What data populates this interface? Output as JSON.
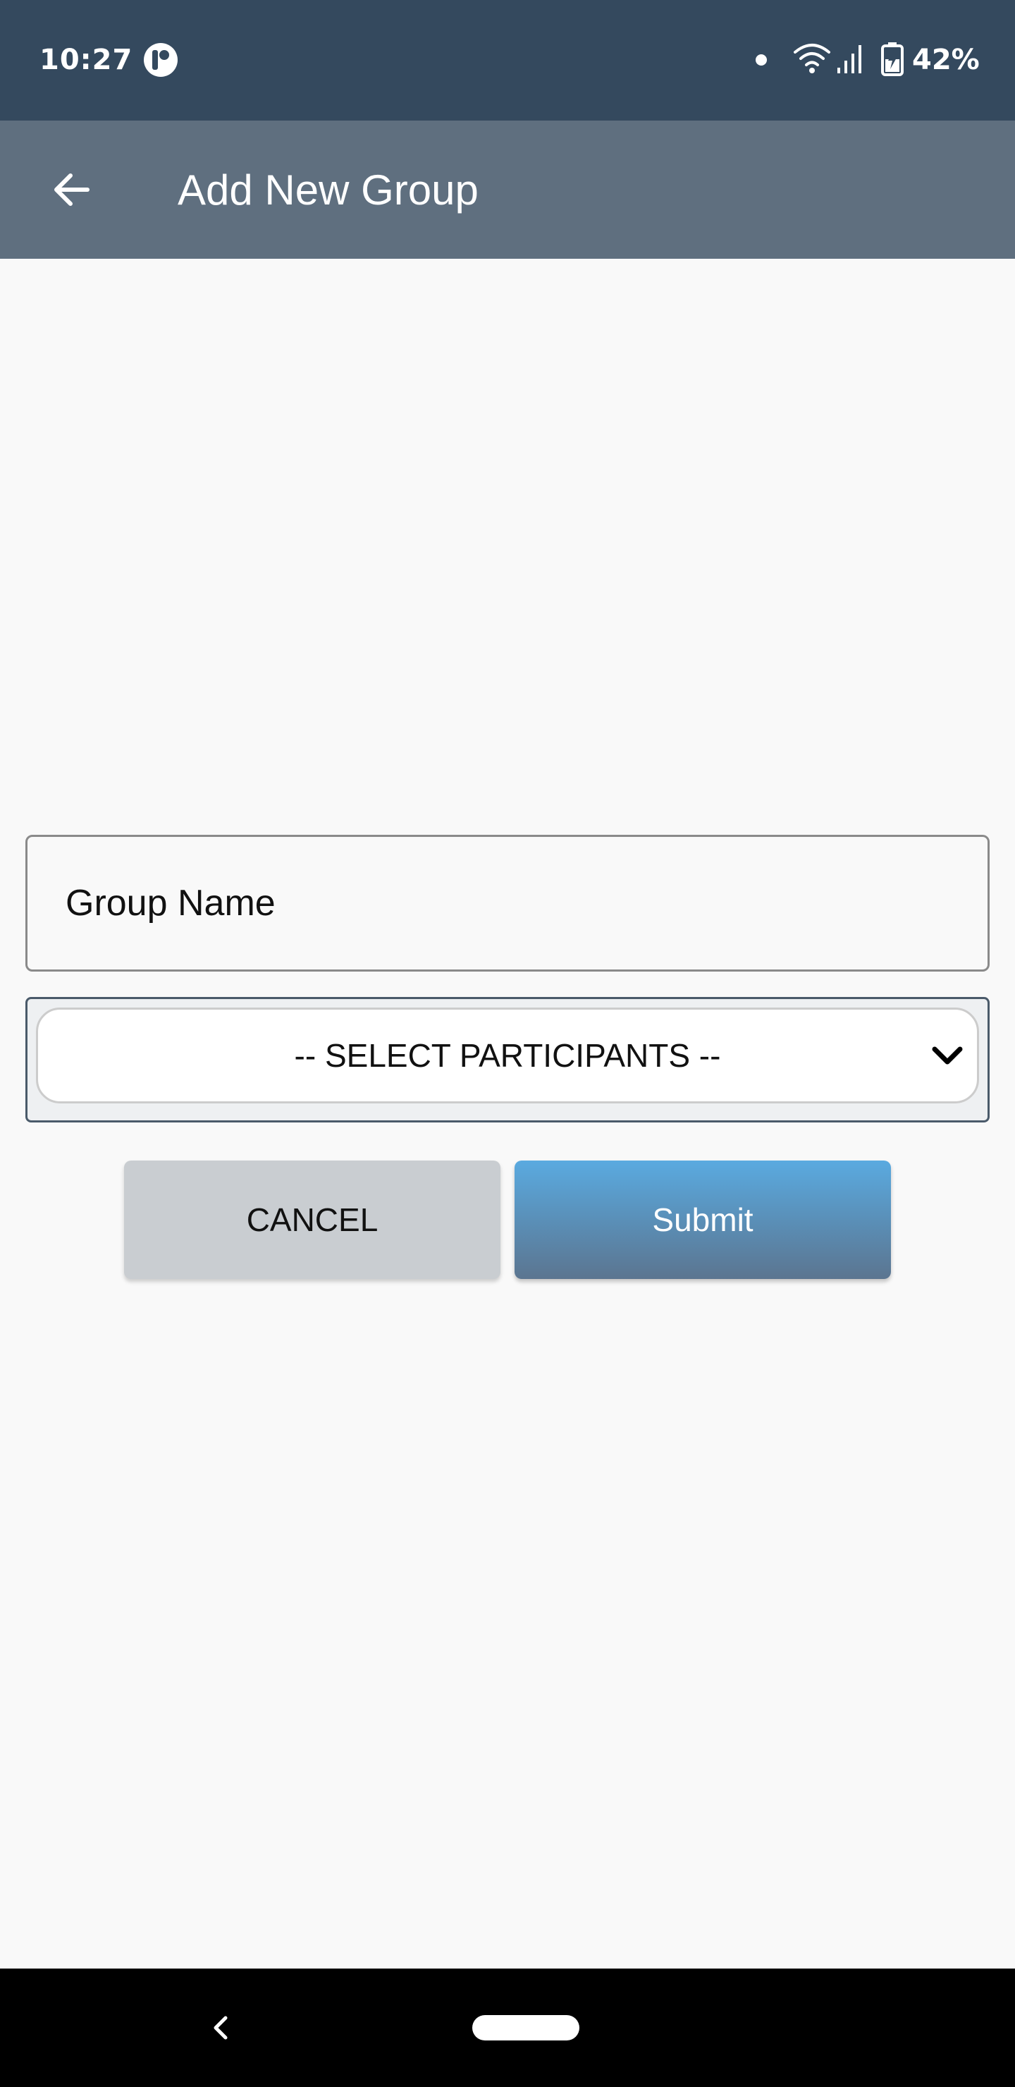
{
  "status_bar": {
    "time": "10:27",
    "battery_percent": "42%",
    "icons": [
      "app-notification-icon",
      "notification-dot",
      "wifi-icon",
      "signal-icon",
      "battery-charging-icon"
    ]
  },
  "app_bar": {
    "title": "Add New Group",
    "back_icon": "arrow-left-icon"
  },
  "form": {
    "group_name_placeholder": "Group Name",
    "group_name_value": "",
    "participants_select": {
      "selected": "-- SELECT PARTICIPANTS --"
    }
  },
  "actions": {
    "cancel_label": "CANCEL",
    "submit_label": "Submit"
  },
  "colors": {
    "status_bar": "#34495e",
    "app_bar": "#5f6f7f",
    "background": "#f9f9f9",
    "cancel_bg": "#c9cdd1",
    "submit_gradient_top": "#5aaae0",
    "submit_gradient_bottom": "#5b7590"
  }
}
